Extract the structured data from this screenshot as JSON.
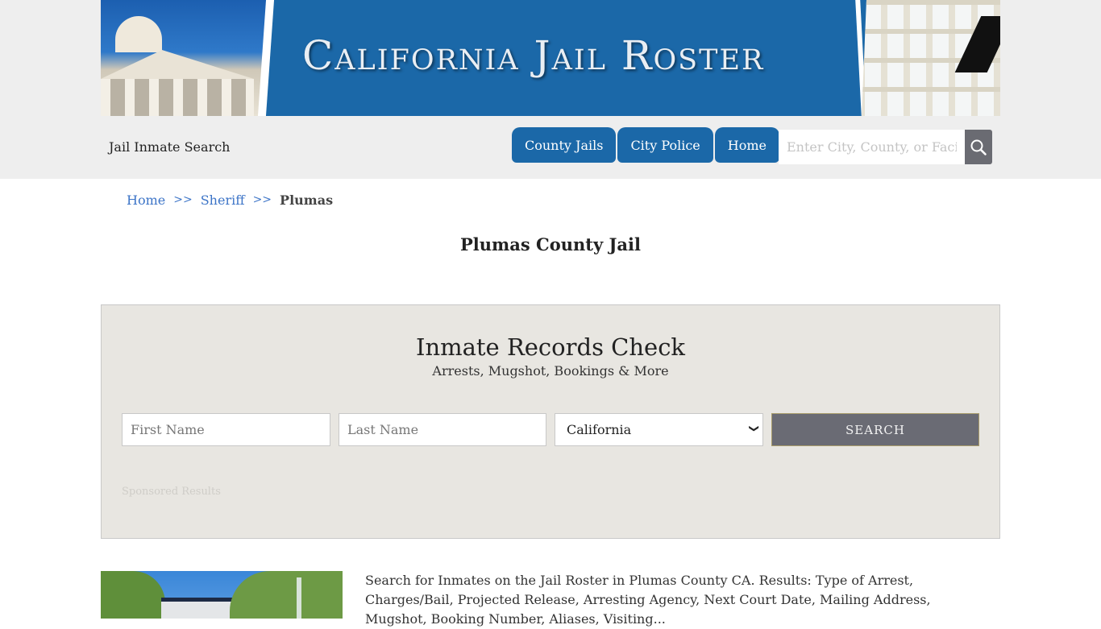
{
  "header": {
    "banner_title": "California Jail Roster",
    "site_name": "Jail Inmate Search",
    "nav": [
      {
        "label": "County Jails"
      },
      {
        "label": "City Police"
      },
      {
        "label": "Home"
      }
    ],
    "search": {
      "placeholder": "Enter City, County, or Facility",
      "value": "",
      "button_icon": "search-icon"
    },
    "brand_color": "#1b68a8"
  },
  "breadcrumb": {
    "items": [
      {
        "label": "Home"
      },
      {
        "label": "Sheriff"
      }
    ],
    "separator": ">>",
    "current": "Plumas"
  },
  "page_title": "Plumas County Jail",
  "records_check": {
    "title": "Inmate Records Check",
    "subtitle": "Arrests, Mugshot, Bookings & More",
    "first_name_placeholder": "First Name",
    "last_name_placeholder": "Last Name",
    "state_selected": "California",
    "search_label": "SEARCH",
    "sponsored_label": "Sponsored Results"
  },
  "content": {
    "description": "Search for Inmates on the Jail Roster in Plumas County CA. Results: Type of Arrest, Charges/Bail, Projected Release, Arresting Agency, Next Court Date, Mailing Address, Mugshot, Booking Number, Aliases, Visiting..."
  }
}
